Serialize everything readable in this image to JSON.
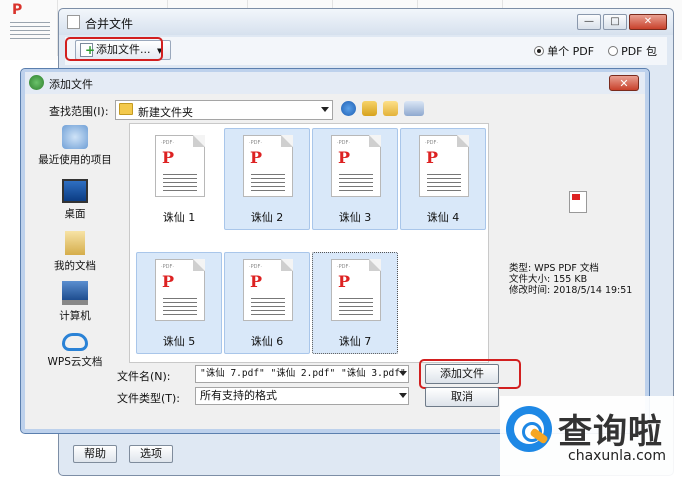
{
  "outer_window": {
    "title": "合并文件",
    "add_file_button": "添加文件...",
    "mode_options": [
      {
        "label": "单个 PDF",
        "selected": true
      },
      {
        "label": "PDF 包",
        "selected": false
      }
    ],
    "help_button": "帮助",
    "options_button": "选项"
  },
  "dialog": {
    "title": "添加文件",
    "close_glyph": "✕",
    "look_in_label": "查找范围(I):",
    "look_in_value": "新建文件夹",
    "places": [
      {
        "label": "最近使用的项目",
        "icon": "recent-icon"
      },
      {
        "label": "桌面",
        "icon": "desktop-icon"
      },
      {
        "label": "我的文档",
        "icon": "documents-icon"
      },
      {
        "label": "计算机",
        "icon": "computer-icon"
      },
      {
        "label": "WPS云文档",
        "icon": "cloud-icon"
      }
    ],
    "files": [
      {
        "name": "诛仙 1",
        "tag": "·PDF·",
        "selected": false
      },
      {
        "name": "诛仙 2",
        "tag": "·PDF·",
        "selected": true
      },
      {
        "name": "诛仙 3",
        "tag": "·PDF·",
        "selected": true
      },
      {
        "name": "诛仙 4",
        "tag": "·PDF·",
        "selected": true
      },
      {
        "name": "诛仙 5",
        "tag": "·PDF·",
        "selected": true
      },
      {
        "name": "诛仙 6",
        "tag": "·PDF·",
        "selected": true
      },
      {
        "name": "诛仙 7",
        "tag": "·PDF·",
        "selected": true,
        "focused": true
      }
    ],
    "file_name_label": "文件名(N):",
    "file_name_value": "\"诛仙 7.pdf\" \"诛仙 2.pdf\" \"诛仙 3.pdf\"",
    "file_type_label": "文件类型(T):",
    "file_type_value": "所有支持的格式",
    "add_button": "添加文件",
    "cancel_button": "取消",
    "preview": {
      "type_line": "类型: WPS PDF 文档",
      "size_line": "文件大小: 155 KB",
      "modified_line": "修改时间: 2018/5/14 19:51"
    }
  },
  "watermark": {
    "cn": "查询啦",
    "en": "chaxunla.com"
  },
  "colors": {
    "highlight_ring": "#d21f1f",
    "selection": "#d9e8f9",
    "pdf_red": "#d22222"
  }
}
